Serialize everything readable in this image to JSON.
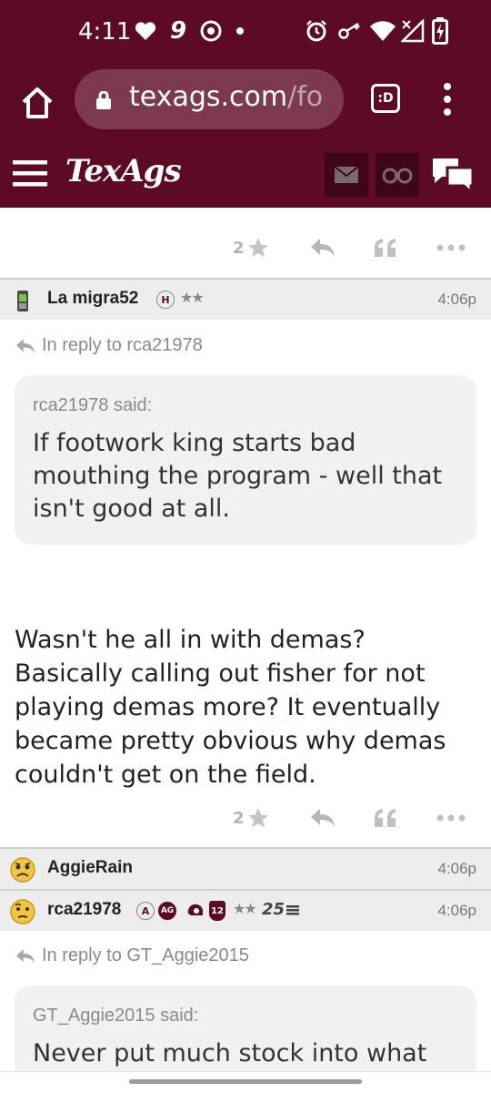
{
  "status_bar": {
    "time": "4:11",
    "icons": [
      "heart-icon",
      "nine-icon",
      "chrome-icon",
      "dot-icon",
      "alarm-icon",
      "key-icon",
      "wifi-icon",
      "no-signal-icon",
      "battery-charging-icon"
    ]
  },
  "browser": {
    "url_host": "texags.com",
    "url_path": "/fo",
    "tab_label": ":D"
  },
  "site": {
    "logo": "TexAgs",
    "brand_color": "#5d0a25"
  },
  "top_actions": {
    "star_count": "2"
  },
  "posts": [
    {
      "author": "La migra52",
      "badge": "H",
      "stars": "★★",
      "time": "4:06p",
      "reply_to": "In reply to rca21978",
      "quote_author": "rca21978 said:",
      "quote_text": "If footwork king starts bad mouthing the program - well that isn't good at all.",
      "body": "Wasn't he all in with demas? Basically calling out fisher for not playing demas more? It eventually became pretty obvious why demas couldn't get on the field.",
      "star_count": "2"
    },
    {
      "author": "AggieRain",
      "time": "4:06p"
    },
    {
      "author": "rca21978",
      "badges": [
        "A",
        "AG",
        "12"
      ],
      "stars": "★★",
      "years": "25",
      "time": "4:06p",
      "reply_to": "In reply to GT_Aggie2015",
      "quote_author": "GT_Aggie2015 said:",
      "quote_text": "Never put much stock into what"
    }
  ]
}
